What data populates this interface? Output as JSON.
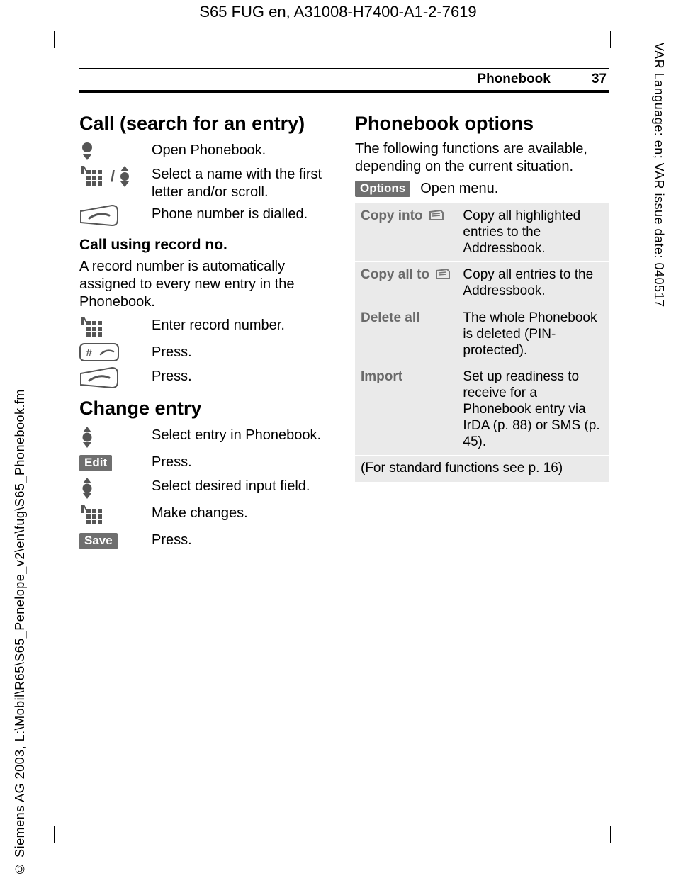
{
  "doc_header": "S65 FUG en, A31008-H7400-A1-2-7619",
  "side_right": "VAR Language: en; VAR issue date: 040517",
  "side_left": "© Siemens AG 2003, L:\\Mobil\\R65\\S65_Penelope_v2\\en\\fug\\S65_Phonebook.fm",
  "running_head": {
    "section": "Phonebook",
    "page": "37"
  },
  "left": {
    "h_call": "Call (search for an entry)",
    "steps_call": {
      "open": "Open Phonebook.",
      "select": "Select a name with the first letter and/or scroll.",
      "dial": "Phone number is dialled."
    },
    "h_recno": "Call using record no.",
    "recno_intro": "A record number is automatically assigned to every new entry in the Phonebook.",
    "steps_recno": {
      "enter": "Enter record number.",
      "press1": "Press.",
      "press2": "Press."
    },
    "h_change": "Change entry",
    "steps_change": {
      "select_entry": "Select entry in Phonebook.",
      "edit_key": "Edit",
      "press_edit": "Press.",
      "select_field": "Select desired input field.",
      "make_changes": "Make changes.",
      "save_key": "Save",
      "press_save": "Press."
    }
  },
  "right": {
    "h_options": "Phonebook options",
    "intro": "The following functions are available, depending on the current situation.",
    "options_key": "Options",
    "open_menu": "Open menu.",
    "table": {
      "rows": [
        {
          "name": "Copy into",
          "icon": true,
          "desc": "Copy all highlighted entries to the Addressbook."
        },
        {
          "name": "Copy all to",
          "icon": true,
          "desc": "Copy all entries to the Addressbook."
        },
        {
          "name": "Delete all",
          "icon": false,
          "desc": "The whole Phonebook is deleted (PIN-protected)."
        },
        {
          "name": "Import",
          "icon": false,
          "desc": "Set up readiness to receive for a Phonebook entry via IrDA (p. 88) or SMS (p. 45)."
        }
      ],
      "footer": "(For standard functions see p. 16)"
    }
  }
}
